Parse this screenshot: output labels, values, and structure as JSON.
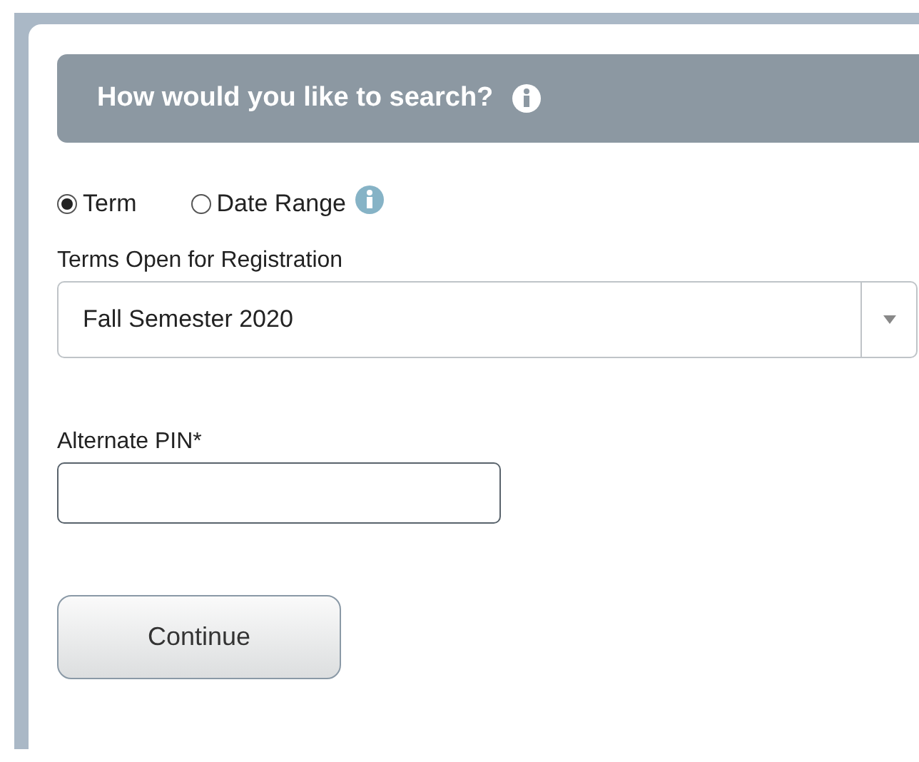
{
  "header": {
    "title": "How would you like to search?"
  },
  "search_by": [
    {
      "label": "Term",
      "selected": true,
      "info": false
    },
    {
      "label": "Date Range",
      "selected": false,
      "info": true
    }
  ],
  "term_select": {
    "label": "Terms Open for Registration",
    "value": "Fall Semester 2020"
  },
  "pin_field": {
    "label": "Alternate PIN*"
  },
  "buttons": [
    "Continue"
  ]
}
